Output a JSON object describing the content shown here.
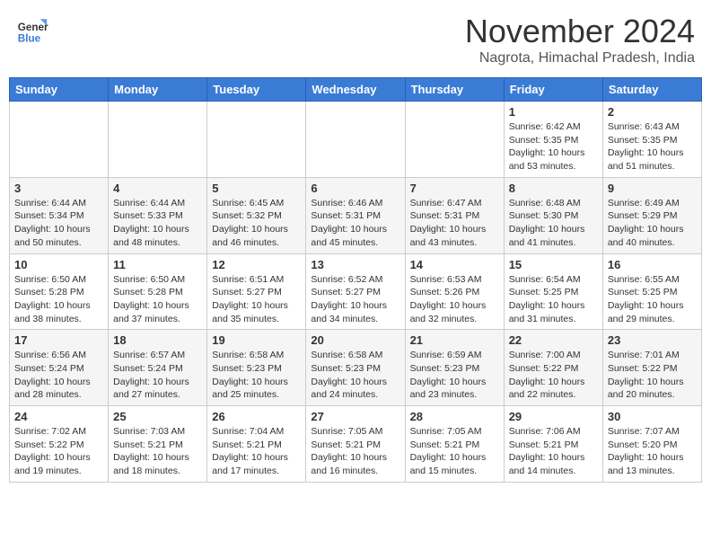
{
  "header": {
    "logo_line1": "General",
    "logo_line2": "Blue",
    "month_title": "November 2024",
    "location": "Nagrota, Himachal Pradesh, India"
  },
  "weekdays": [
    "Sunday",
    "Monday",
    "Tuesday",
    "Wednesday",
    "Thursday",
    "Friday",
    "Saturday"
  ],
  "weeks": [
    [
      {
        "day": "",
        "info": ""
      },
      {
        "day": "",
        "info": ""
      },
      {
        "day": "",
        "info": ""
      },
      {
        "day": "",
        "info": ""
      },
      {
        "day": "",
        "info": ""
      },
      {
        "day": "1",
        "info": "Sunrise: 6:42 AM\nSunset: 5:35 PM\nDaylight: 10 hours and 53 minutes."
      },
      {
        "day": "2",
        "info": "Sunrise: 6:43 AM\nSunset: 5:35 PM\nDaylight: 10 hours and 51 minutes."
      }
    ],
    [
      {
        "day": "3",
        "info": "Sunrise: 6:44 AM\nSunset: 5:34 PM\nDaylight: 10 hours and 50 minutes."
      },
      {
        "day": "4",
        "info": "Sunrise: 6:44 AM\nSunset: 5:33 PM\nDaylight: 10 hours and 48 minutes."
      },
      {
        "day": "5",
        "info": "Sunrise: 6:45 AM\nSunset: 5:32 PM\nDaylight: 10 hours and 46 minutes."
      },
      {
        "day": "6",
        "info": "Sunrise: 6:46 AM\nSunset: 5:31 PM\nDaylight: 10 hours and 45 minutes."
      },
      {
        "day": "7",
        "info": "Sunrise: 6:47 AM\nSunset: 5:31 PM\nDaylight: 10 hours and 43 minutes."
      },
      {
        "day": "8",
        "info": "Sunrise: 6:48 AM\nSunset: 5:30 PM\nDaylight: 10 hours and 41 minutes."
      },
      {
        "day": "9",
        "info": "Sunrise: 6:49 AM\nSunset: 5:29 PM\nDaylight: 10 hours and 40 minutes."
      }
    ],
    [
      {
        "day": "10",
        "info": "Sunrise: 6:50 AM\nSunset: 5:28 PM\nDaylight: 10 hours and 38 minutes."
      },
      {
        "day": "11",
        "info": "Sunrise: 6:50 AM\nSunset: 5:28 PM\nDaylight: 10 hours and 37 minutes."
      },
      {
        "day": "12",
        "info": "Sunrise: 6:51 AM\nSunset: 5:27 PM\nDaylight: 10 hours and 35 minutes."
      },
      {
        "day": "13",
        "info": "Sunrise: 6:52 AM\nSunset: 5:27 PM\nDaylight: 10 hours and 34 minutes."
      },
      {
        "day": "14",
        "info": "Sunrise: 6:53 AM\nSunset: 5:26 PM\nDaylight: 10 hours and 32 minutes."
      },
      {
        "day": "15",
        "info": "Sunrise: 6:54 AM\nSunset: 5:25 PM\nDaylight: 10 hours and 31 minutes."
      },
      {
        "day": "16",
        "info": "Sunrise: 6:55 AM\nSunset: 5:25 PM\nDaylight: 10 hours and 29 minutes."
      }
    ],
    [
      {
        "day": "17",
        "info": "Sunrise: 6:56 AM\nSunset: 5:24 PM\nDaylight: 10 hours and 28 minutes."
      },
      {
        "day": "18",
        "info": "Sunrise: 6:57 AM\nSunset: 5:24 PM\nDaylight: 10 hours and 27 minutes."
      },
      {
        "day": "19",
        "info": "Sunrise: 6:58 AM\nSunset: 5:23 PM\nDaylight: 10 hours and 25 minutes."
      },
      {
        "day": "20",
        "info": "Sunrise: 6:58 AM\nSunset: 5:23 PM\nDaylight: 10 hours and 24 minutes."
      },
      {
        "day": "21",
        "info": "Sunrise: 6:59 AM\nSunset: 5:23 PM\nDaylight: 10 hours and 23 minutes."
      },
      {
        "day": "22",
        "info": "Sunrise: 7:00 AM\nSunset: 5:22 PM\nDaylight: 10 hours and 22 minutes."
      },
      {
        "day": "23",
        "info": "Sunrise: 7:01 AM\nSunset: 5:22 PM\nDaylight: 10 hours and 20 minutes."
      }
    ],
    [
      {
        "day": "24",
        "info": "Sunrise: 7:02 AM\nSunset: 5:22 PM\nDaylight: 10 hours and 19 minutes."
      },
      {
        "day": "25",
        "info": "Sunrise: 7:03 AM\nSunset: 5:21 PM\nDaylight: 10 hours and 18 minutes."
      },
      {
        "day": "26",
        "info": "Sunrise: 7:04 AM\nSunset: 5:21 PM\nDaylight: 10 hours and 17 minutes."
      },
      {
        "day": "27",
        "info": "Sunrise: 7:05 AM\nSunset: 5:21 PM\nDaylight: 10 hours and 16 minutes."
      },
      {
        "day": "28",
        "info": "Sunrise: 7:05 AM\nSunset: 5:21 PM\nDaylight: 10 hours and 15 minutes."
      },
      {
        "day": "29",
        "info": "Sunrise: 7:06 AM\nSunset: 5:21 PM\nDaylight: 10 hours and 14 minutes."
      },
      {
        "day": "30",
        "info": "Sunrise: 7:07 AM\nSunset: 5:20 PM\nDaylight: 10 hours and 13 minutes."
      }
    ]
  ]
}
